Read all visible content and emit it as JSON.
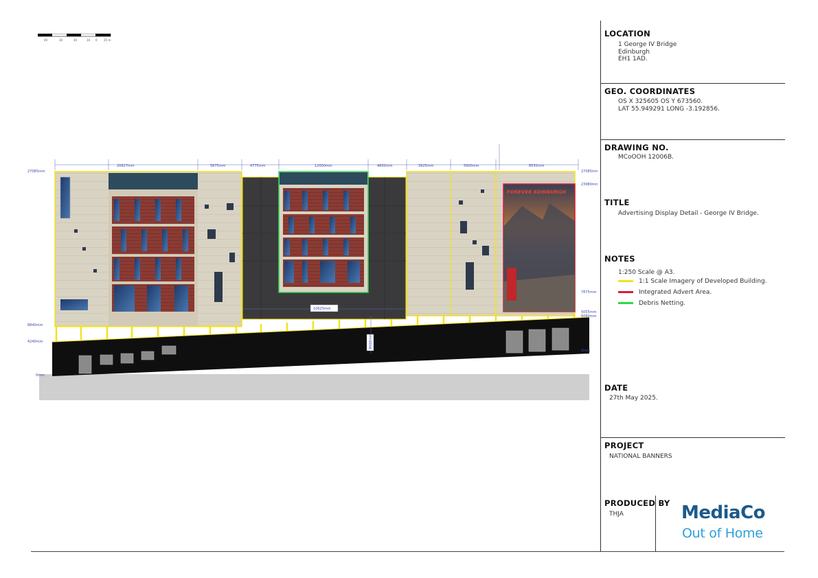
{
  "scale_bar": {
    "ticks": [
      "40",
      "30",
      "20",
      "10",
      "0",
      "25 m"
    ]
  },
  "title_block": {
    "location": {
      "heading": "LOCATION",
      "lines": [
        "1 George IV Bridge",
        "Edinburgh",
        "EH1 1AD."
      ]
    },
    "geo": {
      "heading": "GEO. COORDINATES",
      "lines": [
        "OS X 325605 OS Y 673560.",
        "LAT 55.949291 LONG -3.192856."
      ]
    },
    "drawing_no": {
      "heading": "DRAWING NO.",
      "value": "MCoOOH 12006B."
    },
    "title": {
      "heading": "TITLE",
      "value": "Advertising Display Detail - George IV Bridge."
    },
    "notes": {
      "heading": "NOTES",
      "scale": "1:250 Scale @ A3.",
      "legend": [
        {
          "label": "1:1 Scale Imagery of Developed Building.",
          "color": "#f2e21a"
        },
        {
          "label": "Integrated Advert Area.",
          "color": "#d81b3c"
        },
        {
          "label": "Debris Netting.",
          "color": "#2bd94a"
        }
      ]
    },
    "date": {
      "heading": "DATE",
      "value": "27th May 2025."
    },
    "project": {
      "heading": "PROJECT",
      "value": "NATIONAL BANNERS"
    },
    "produced_by": {
      "heading": "PRODUCED BY",
      "value": "THJA"
    },
    "logo": {
      "line1": "MediaCo",
      "line2": "Out of Home"
    }
  },
  "drawing": {
    "advert_text": "FOREVER EDINBURGH",
    "dimensions_top": [
      "20627mm",
      "5875mm",
      "4775mm",
      "12000mm",
      "4800mm",
      "3925mm",
      "5900mm",
      "8530mm"
    ],
    "dimensions_left": [
      "27085mm",
      "8840mm",
      "4240mm",
      "0mm"
    ],
    "dimensions_right": [
      "27085mm",
      "23980mm",
      "7875mm",
      "5055mm",
      "6060mm",
      "0mm"
    ],
    "dimension_mid_horizontal": "10625mm",
    "dimension_mid_vertical": "9000mm"
  },
  "colors": {
    "yellow": "#f2e21a",
    "red": "#d81b3c",
    "green": "#2bd94a",
    "dark": "#3a3a3c",
    "stone": "#d9d3c4",
    "brick": "#8a3b33"
  }
}
